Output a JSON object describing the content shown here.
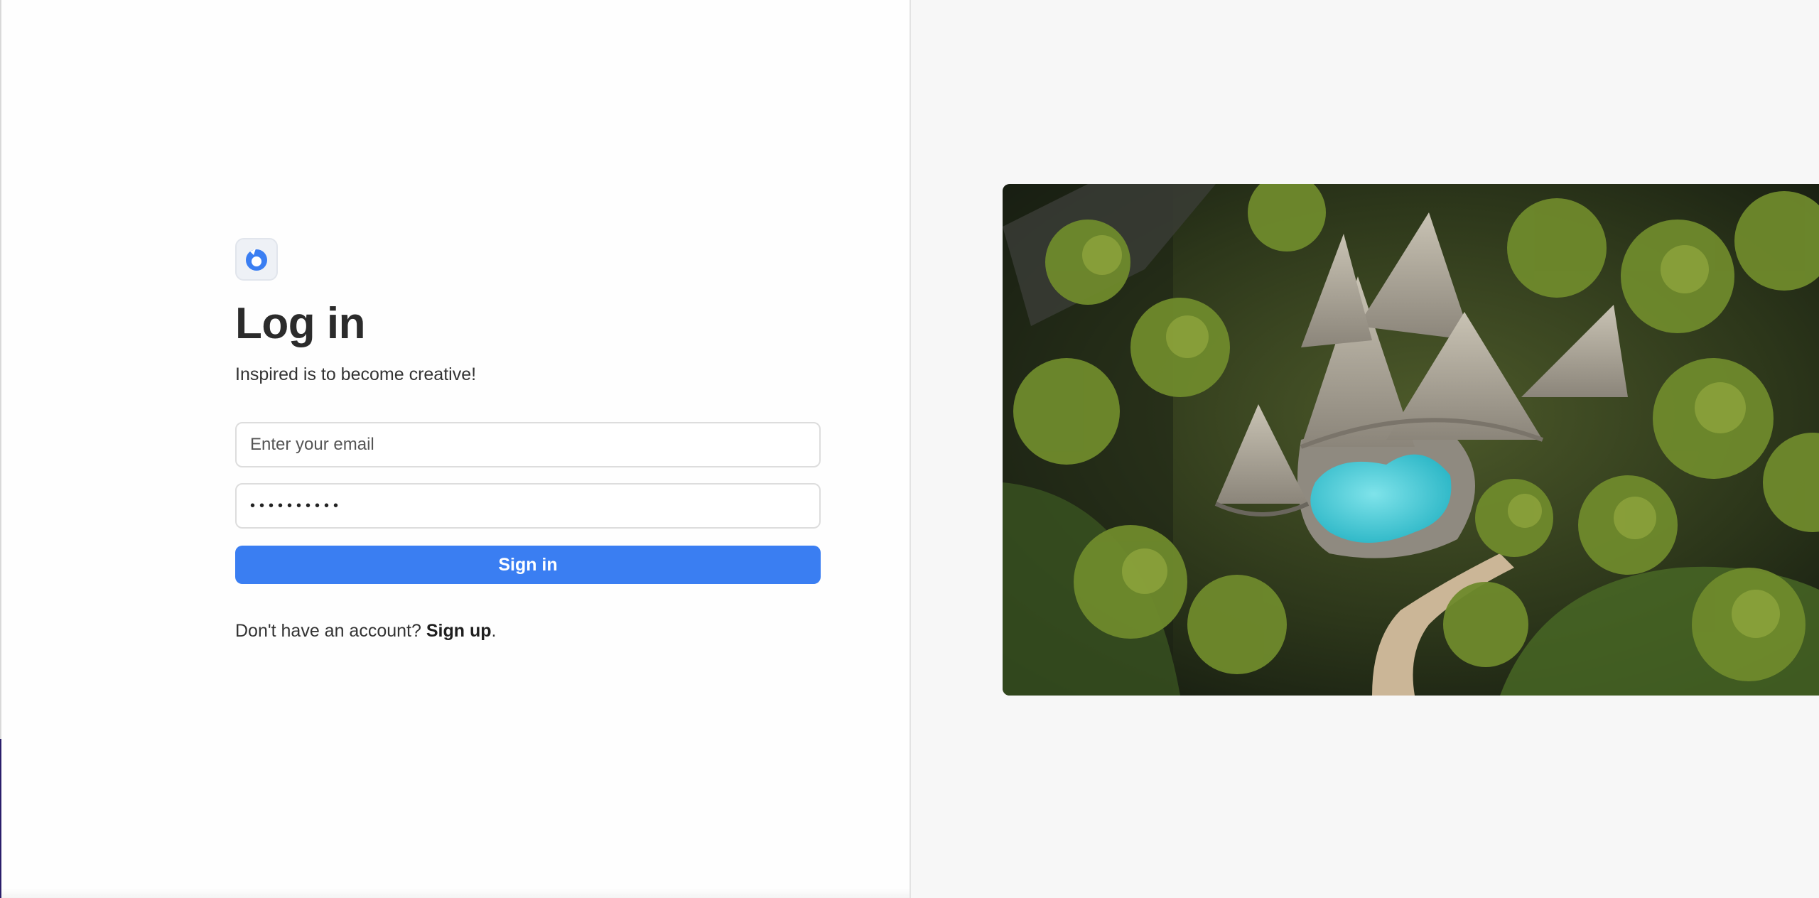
{
  "login": {
    "title": "Log in",
    "subtitle": "Inspired is to become creative!",
    "email_placeholder": "Enter your email",
    "password_value": "••••••••••",
    "signin_label": "Sign in",
    "signup_prompt": "Don't have an account?",
    "signup_link": "Sign up",
    "signup_suffix": "."
  },
  "colors": {
    "primary": "#3a7ef2",
    "logo": "#3a7ef2",
    "right_background": "#f7f7f7"
  },
  "icons": {
    "logo": "brand-logo-icon"
  }
}
